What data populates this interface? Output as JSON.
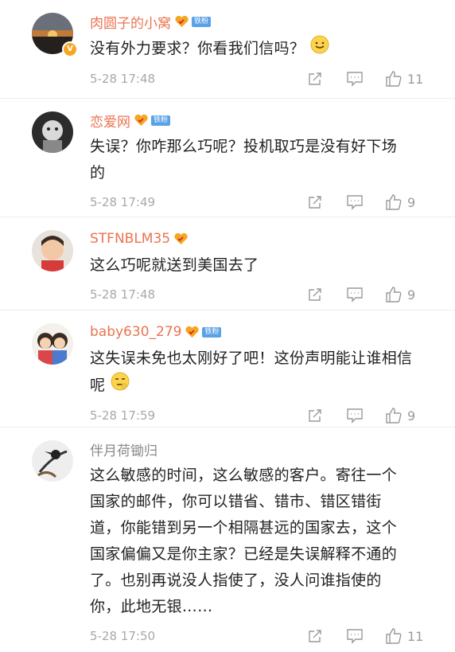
{
  "comments": [
    {
      "username": "肉圆子的小窝",
      "fan_label": "铁粉",
      "text": "没有外力要求？你看我们信吗？",
      "emoji": "smile-emoji",
      "time": "5-28 17:48",
      "likes": "11",
      "verified_badge": "V"
    },
    {
      "username": "恋爱网",
      "fan_label": "铁粉",
      "text": "失误？你咋那么巧呢？投机取巧是没有好下场的",
      "time": "5-28 17:49",
      "likes": "9"
    },
    {
      "username": "STFNBLM35",
      "text": "这么巧呢就送到美国去了",
      "time": "5-28 17:48",
      "likes": "9"
    },
    {
      "username": "baby630_279",
      "fan_label": "铁粉",
      "text": "这失误未免也太刚好了吧！这份声明能让谁相信呢",
      "emoji": "thinking-emoji",
      "time": "5-28 17:59",
      "likes": "9"
    },
    {
      "username": "伴月荷锄归",
      "text": "这么敏感的时间，这么敏感的客户。寄往一个国家的邮件，你可以错省、错市、错区错街道，你能错到另一个相隔甚远的国家去，这个国家偏偏又是你主家？已经是失误解释不通的了。也别再说没人指使了，没人问谁指使的你，此地无银……",
      "time": "5-28 17:50",
      "likes": "11"
    }
  ],
  "colors": {
    "username": "#eb7350",
    "plain_username": "#8a8a8a",
    "meta": "#a8a8a8",
    "fan_badge": "#5aa1e6"
  },
  "icons": [
    "share-icon",
    "reply-icon",
    "thumbs-up-icon",
    "fan-heart-icon"
  ]
}
